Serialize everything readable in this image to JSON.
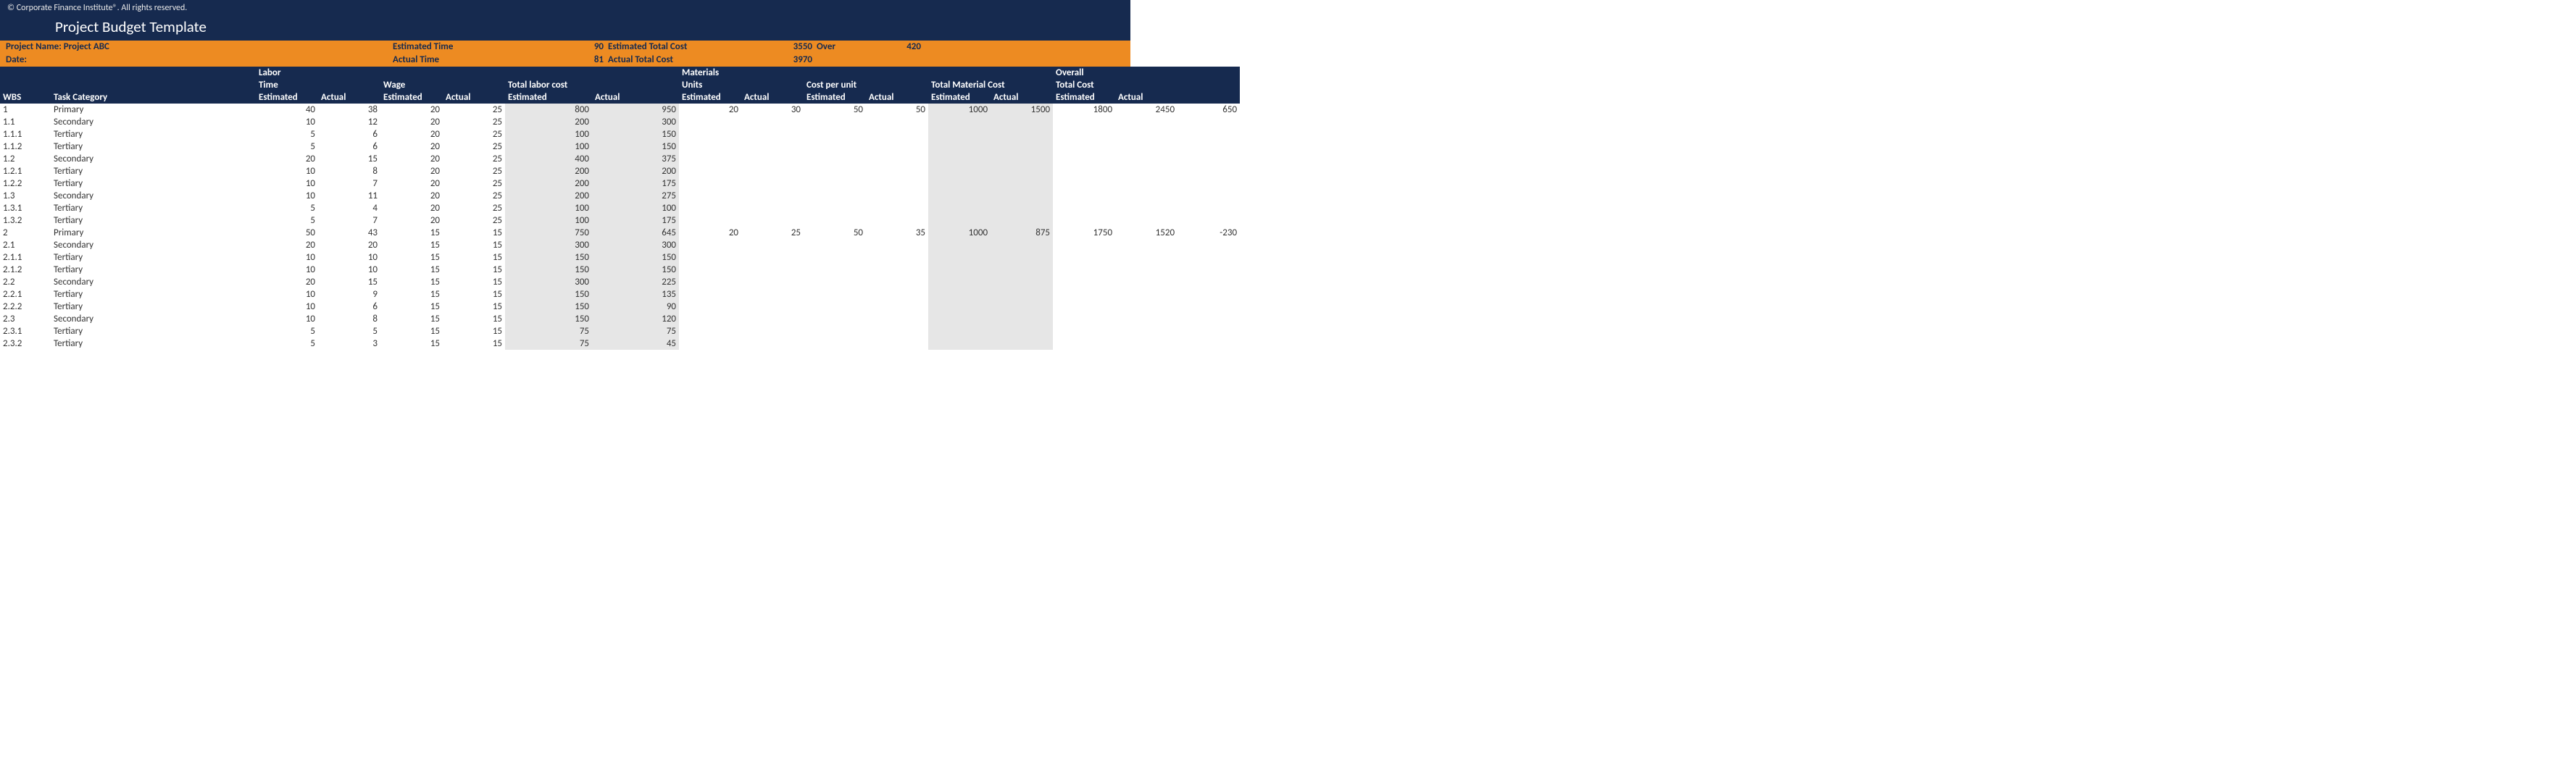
{
  "copyright": "© Corporate Finance Institute®. All rights reserved.",
  "title": "Project Budget Template",
  "summary": {
    "row1": {
      "projectName": "Project Name: Project ABC",
      "estTimeLabel": "Estimated Time",
      "estTimeVal": "90",
      "estTotalCostLabel": "Estimated Total Cost",
      "estTotalCostVal": "3550",
      "overLabel": "Over",
      "overVal": "420"
    },
    "row2": {
      "dateLabel": "Date:",
      "actTimeLabel": "Actual Time",
      "actTimeVal": "81",
      "actTotalCostLabel": "Actual Total Cost",
      "actTotalCostVal": "3970"
    }
  },
  "headers": {
    "wbs": "WBS",
    "task": "Task Category",
    "laborGroup": "Labor",
    "timeGroup": "Time",
    "wageGroup": "Wage",
    "totalLaborGroup": "Total labor cost",
    "materialsGroup": "Materials",
    "unitsGroup": "Units",
    "cpuGroup": "Cost per unit",
    "totalMaterialGroup": "Total Material Cost",
    "overallGroup": "Overall",
    "totalCostGroup": "Total Cost",
    "est": "Estimated",
    "act": "Actual"
  },
  "rows": [
    {
      "wbs": "1",
      "task": "Primary",
      "timeEst": "40",
      "timeAct": "38",
      "wageEst": "20",
      "wageAct": "25",
      "tlcEst": "800",
      "tlcAct": "950",
      "unitsEst": "20",
      "unitsAct": "30",
      "cpuEst": "50",
      "cpuAct": "50",
      "tmcEst": "1000",
      "tmcAct": "1500",
      "totEst": "1800",
      "totAct": "2450",
      "diff": "650"
    },
    {
      "wbs": "1.1",
      "task": "Secondary",
      "timeEst": "10",
      "timeAct": "12",
      "wageEst": "20",
      "wageAct": "25",
      "tlcEst": "200",
      "tlcAct": "300"
    },
    {
      "wbs": "1.1.1",
      "task": "Tertiary",
      "timeEst": "5",
      "timeAct": "6",
      "wageEst": "20",
      "wageAct": "25",
      "tlcEst": "100",
      "tlcAct": "150"
    },
    {
      "wbs": "1.1.2",
      "task": "Tertiary",
      "timeEst": "5",
      "timeAct": "6",
      "wageEst": "20",
      "wageAct": "25",
      "tlcEst": "100",
      "tlcAct": "150"
    },
    {
      "wbs": "1.2",
      "task": "Secondary",
      "timeEst": "20",
      "timeAct": "15",
      "wageEst": "20",
      "wageAct": "25",
      "tlcEst": "400",
      "tlcAct": "375"
    },
    {
      "wbs": "1.2.1",
      "task": "Tertiary",
      "timeEst": "10",
      "timeAct": "8",
      "wageEst": "20",
      "wageAct": "25",
      "tlcEst": "200",
      "tlcAct": "200"
    },
    {
      "wbs": "1.2.2",
      "task": "Tertiary",
      "timeEst": "10",
      "timeAct": "7",
      "wageEst": "20",
      "wageAct": "25",
      "tlcEst": "200",
      "tlcAct": "175"
    },
    {
      "wbs": "1.3",
      "task": "Secondary",
      "timeEst": "10",
      "timeAct": "11",
      "wageEst": "20",
      "wageAct": "25",
      "tlcEst": "200",
      "tlcAct": "275"
    },
    {
      "wbs": "1.3.1",
      "task": "Tertiary",
      "timeEst": "5",
      "timeAct": "4",
      "wageEst": "20",
      "wageAct": "25",
      "tlcEst": "100",
      "tlcAct": "100"
    },
    {
      "wbs": "1.3.2",
      "task": "Tertiary",
      "timeEst": "5",
      "timeAct": "7",
      "wageEst": "20",
      "wageAct": "25",
      "tlcEst": "100",
      "tlcAct": "175"
    },
    {
      "wbs": "2",
      "task": "Primary",
      "timeEst": "50",
      "timeAct": "43",
      "wageEst": "15",
      "wageAct": "15",
      "tlcEst": "750",
      "tlcAct": "645",
      "unitsEst": "20",
      "unitsAct": "25",
      "cpuEst": "50",
      "cpuAct": "35",
      "tmcEst": "1000",
      "tmcAct": "875",
      "totEst": "1750",
      "totAct": "1520",
      "diff": "-230"
    },
    {
      "wbs": "2.1",
      "task": "Secondary",
      "timeEst": "20",
      "timeAct": "20",
      "wageEst": "15",
      "wageAct": "15",
      "tlcEst": "300",
      "tlcAct": "300"
    },
    {
      "wbs": "2.1.1",
      "task": "Tertiary",
      "timeEst": "10",
      "timeAct": "10",
      "wageEst": "15",
      "wageAct": "15",
      "tlcEst": "150",
      "tlcAct": "150"
    },
    {
      "wbs": "2.1.2",
      "task": "Tertiary",
      "timeEst": "10",
      "timeAct": "10",
      "wageEst": "15",
      "wageAct": "15",
      "tlcEst": "150",
      "tlcAct": "150"
    },
    {
      "wbs": "2.2",
      "task": "Secondary",
      "timeEst": "20",
      "timeAct": "15",
      "wageEst": "15",
      "wageAct": "15",
      "tlcEst": "300",
      "tlcAct": "225"
    },
    {
      "wbs": "2.2.1",
      "task": "Tertiary",
      "timeEst": "10",
      "timeAct": "9",
      "wageEst": "15",
      "wageAct": "15",
      "tlcEst": "150",
      "tlcAct": "135"
    },
    {
      "wbs": "2.2.2",
      "task": "Tertiary",
      "timeEst": "10",
      "timeAct": "6",
      "wageEst": "15",
      "wageAct": "15",
      "tlcEst": "150",
      "tlcAct": "90"
    },
    {
      "wbs": "2.3",
      "task": "Secondary",
      "timeEst": "10",
      "timeAct": "8",
      "wageEst": "15",
      "wageAct": "15",
      "tlcEst": "150",
      "tlcAct": "120"
    },
    {
      "wbs": "2.3.1",
      "task": "Tertiary",
      "timeEst": "5",
      "timeAct": "5",
      "wageEst": "15",
      "wageAct": "15",
      "tlcEst": "75",
      "tlcAct": "75"
    },
    {
      "wbs": "2.3.2",
      "task": "Tertiary",
      "timeEst": "5",
      "timeAct": "3",
      "wageEst": "15",
      "wageAct": "15",
      "tlcEst": "75",
      "tlcAct": "45"
    }
  ]
}
